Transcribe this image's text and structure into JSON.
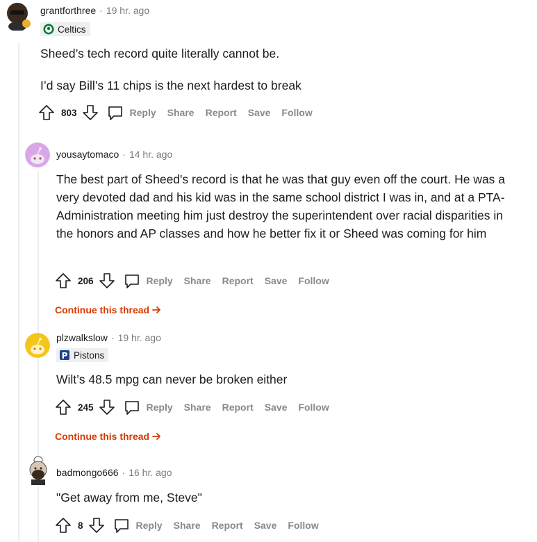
{
  "comments": [
    {
      "username": "grantforthree",
      "time": "19 hr. ago",
      "flair": "Celtics",
      "body": [
        "Sheed’s tech record quite literally cannot be.",
        "I’d say Bill’s 11 chips is the next hardest to break"
      ],
      "score": "803"
    },
    {
      "username": "yousaytomaco",
      "time": "14 hr. ago",
      "body": [
        "The best part of Sheed's record is that he was that guy even off the court. He was a very devoted dad and his kid was in the same school district I was in, and at a PTA-Administration meeting him just destroy the superintendent over racial disparities in the honors and AP classes and how he better fix it or Sheed was coming for him"
      ],
      "score": "206",
      "continue": "Continue this thread"
    },
    {
      "username": "plzwalkslow",
      "time": "19 hr. ago",
      "flair": "Pistons",
      "body": [
        "Wilt’s 48.5 mpg can never be broken either"
      ],
      "score": "245",
      "continue": "Continue this thread"
    },
    {
      "username": "badmongo666",
      "time": "16 hr. ago",
      "body": [
        "\"Get away from me, Steve\""
      ],
      "score": "8"
    }
  ],
  "actions": {
    "reply": "Reply",
    "share": "Share",
    "report": "Report",
    "save": "Save",
    "follow": "Follow"
  },
  "colors": {
    "accent_link": "#d93a00",
    "muted": "#878a8c",
    "thread_line": "#edeff1"
  }
}
